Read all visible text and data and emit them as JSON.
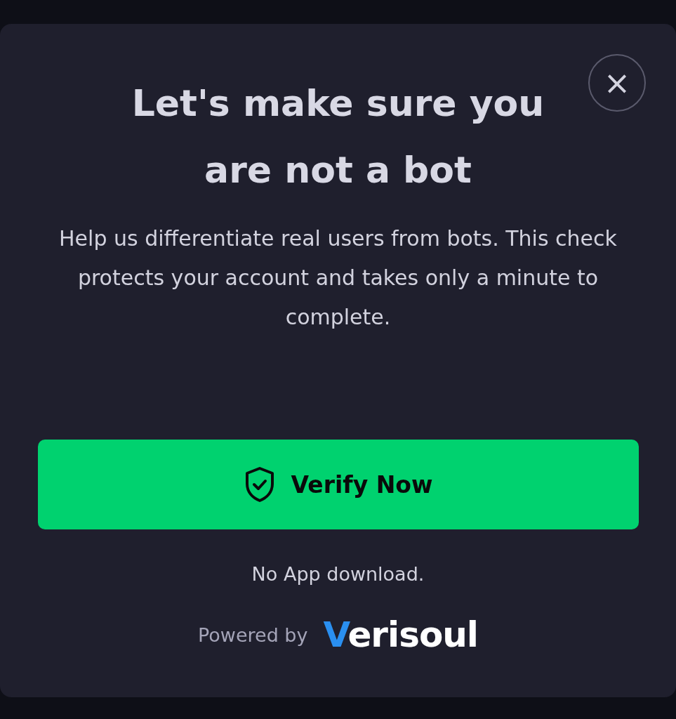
{
  "dialog": {
    "title": "Let's make sure you are not a bot",
    "description": "Help us differentiate real users from bots. This check protects your account and takes only a minute to complete.",
    "close_button": "×",
    "primary_button": "Verify Now",
    "note": "No App download.",
    "footer": {
      "powered_by": "Powered by",
      "brand": "Verisoul"
    }
  }
}
